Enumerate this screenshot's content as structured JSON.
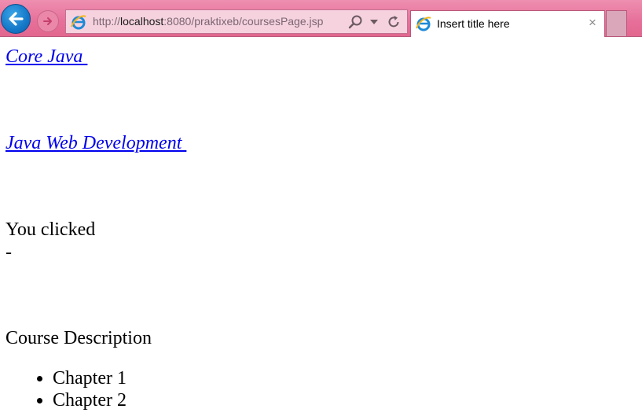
{
  "browser": {
    "url_prefix": "http://",
    "url_host": "localhost",
    "url_rest": ":8080/praktixeb/coursesPage.jsp",
    "tab_title": "Insert title here",
    "tab_close": "×",
    "theme_color": "#e66f99",
    "back_button_color": "#1478c8"
  },
  "page": {
    "links": [
      {
        "label": "Core Java "
      },
      {
        "label": "Java Web Development "
      }
    ],
    "you_clicked": "You clicked",
    "selected_value": "-",
    "description_heading": "Course Description",
    "chapters": [
      "Chapter 1",
      "Chapter 2"
    ],
    "link_color": "#0000ee"
  }
}
